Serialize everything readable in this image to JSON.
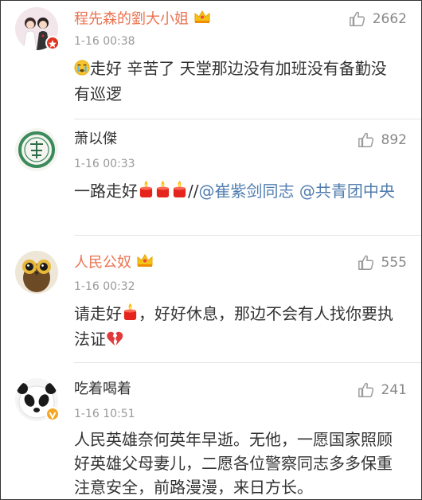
{
  "comments": [
    {
      "name": "程先森的劉大小姐",
      "likes": "2662",
      "time": "1-16 00:38",
      "text_after_emoji": "走好  辛苦了  天堂那边没有加班没有备勤没有巡逻"
    },
    {
      "name": "萧以傑",
      "likes": "892",
      "time": "1-16 00:33",
      "text_before_emoji": "一路走好",
      "separator": "//",
      "mention1": "@崔紫剑同志",
      "mention2": "@共青团中央"
    },
    {
      "name": "人民公奴",
      "likes": "555",
      "time": "1-16 00:32",
      "text_before_emoji": "请走好",
      "text_middle": "，好好休息，那边不会有人找你要执法证"
    },
    {
      "name": "吃着喝着",
      "likes": "241",
      "time": "1-16 10:51",
      "text": "人民英雄奈何英年早逝。无他，一愿国家照顾好英雄父母妻儿，二愿各位警察同志多多保重注意安全，前路漫漫，来日方长。"
    }
  ],
  "colors": {
    "vip_name": "#eb7350",
    "mention": "#507daf",
    "meta": "#999999"
  },
  "icons": [
    "thumbs-up-icon",
    "crown-icon",
    "candle-icon",
    "crying-face-icon",
    "broken-heart-icon",
    "verified-badge-icon",
    "red-star-badge-icon"
  ]
}
